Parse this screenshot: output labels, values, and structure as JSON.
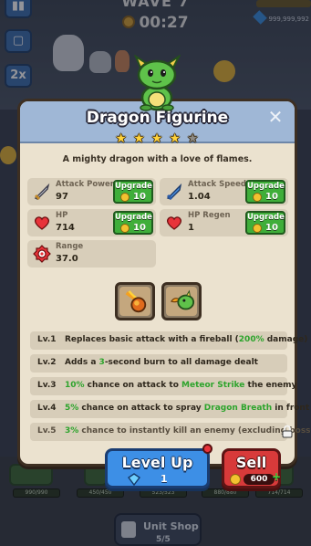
{
  "hud": {
    "wave_label": "WAVE 7",
    "timer": "00:27",
    "speed_label": "2x",
    "currency_amount": "999,999,992"
  },
  "panel": {
    "title": "Dragon Figurine",
    "stars_filled": 4,
    "stars_total": 5,
    "close_symbol": "✕",
    "description": "A mighty dragon with a love of flames."
  },
  "stats": [
    {
      "name": "Attack Power",
      "value": "97",
      "icon": "sword-icon",
      "upgrade_label": "Upgrade",
      "upgrade_cost": "10"
    },
    {
      "name": "Attack Speed",
      "value": "1.04",
      "icon": "dagger-icon",
      "upgrade_label": "Upgrade",
      "upgrade_cost": "10"
    },
    {
      "name": "HP",
      "value": "714",
      "icon": "heart-icon",
      "upgrade_label": "Upgrade",
      "upgrade_cost": "10"
    },
    {
      "name": "HP Regen",
      "value": "1",
      "icon": "heart-regen-icon",
      "upgrade_label": "Upgrade",
      "upgrade_cost": "10"
    },
    {
      "name": "Range",
      "value": "37.0",
      "icon": "target-icon"
    }
  ],
  "skills": [
    {
      "icon": "meteor-icon"
    },
    {
      "icon": "dragon-breath-icon"
    }
  ],
  "levels": [
    {
      "lv": "Lv.1",
      "parts": [
        "Replaces basic attack with a fireball (",
        "200%",
        " damage)"
      ]
    },
    {
      "lv": "Lv.2",
      "parts": [
        "Adds a ",
        "3",
        "-second burn to all damage dealt"
      ]
    },
    {
      "lv": "Lv.3",
      "parts": [
        "",
        "10%",
        " chance on attack to ",
        "Meteor Strike",
        " the enemy"
      ]
    },
    {
      "lv": "Lv.4",
      "parts": [
        "",
        "5%",
        " chance on attack to spray ",
        "Dragon Breath",
        " in front"
      ]
    },
    {
      "lv": "Lv.5",
      "parts": [
        "",
        "3%",
        " chance to instantly kill an enemy (excluding bosses)"
      ],
      "locked": true
    }
  ],
  "actions": {
    "level_up_label": "Level Up",
    "level_up_cost": "1",
    "sell_label": "Sell",
    "sell_price": "600",
    "sell_plus": "+"
  },
  "units_hp": [
    "990/990",
    "450/450",
    "523/523",
    "880/880",
    "714/714"
  ],
  "unit_shop": {
    "label": "Unit Shop",
    "count": "5/5"
  },
  "colors": {
    "panel_bg": "#ebe2cf",
    "header_bg": "#9fb7d6",
    "upgrade_green": "#3fae3a",
    "level_up_blue": "#3d8fe6",
    "sell_red": "#d83a3a",
    "highlight_green": "#2da42c"
  }
}
